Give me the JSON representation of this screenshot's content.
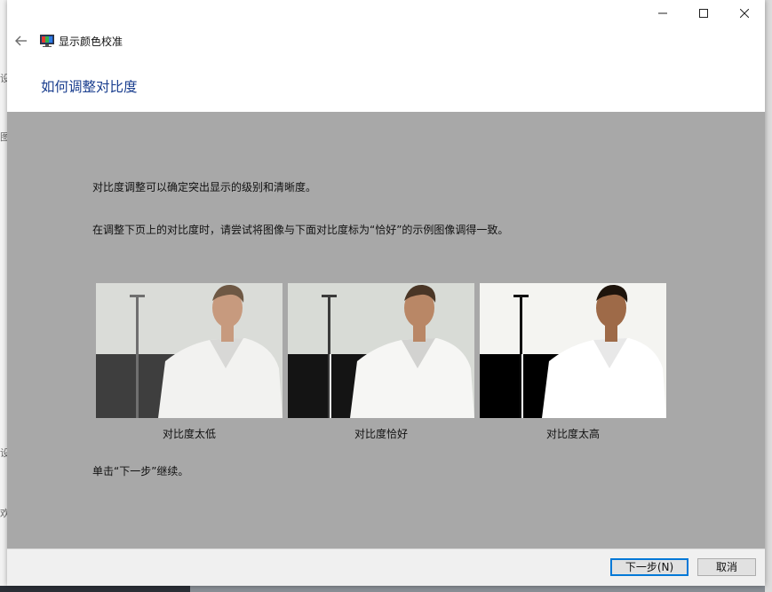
{
  "window": {
    "app_title": "显示颜色校准",
    "icons": {
      "back": "back-arrow-icon",
      "app": "display-color-icon",
      "minimize": "minimize-icon",
      "maximize": "maximize-icon",
      "close": "close-icon"
    }
  },
  "heading": "如何调整对比度",
  "content": {
    "paragraph1": "对比度调整可以确定突出显示的级别和清晰度。",
    "paragraph2": "在调整下页上的对比度时，请尝试将图像与下面对比度标为“恰好”的示例图像调得一致。",
    "samples": [
      {
        "caption": "对比度太低",
        "level": "low"
      },
      {
        "caption": "对比度恰好",
        "level": "good"
      },
      {
        "caption": "对比度太高",
        "level": "high"
      }
    ],
    "paragraph3": "单击“下一步”继续。"
  },
  "footer": {
    "next_label": "下一步(N)",
    "cancel_label": "取消"
  },
  "background_window": {
    "fragments": [
      "设",
      "图",
      "设",
      "欢"
    ]
  },
  "colors": {
    "heading": "#1b3f8f",
    "content_bg": "#a8a8a8",
    "default_button_border": "#0078d7"
  }
}
